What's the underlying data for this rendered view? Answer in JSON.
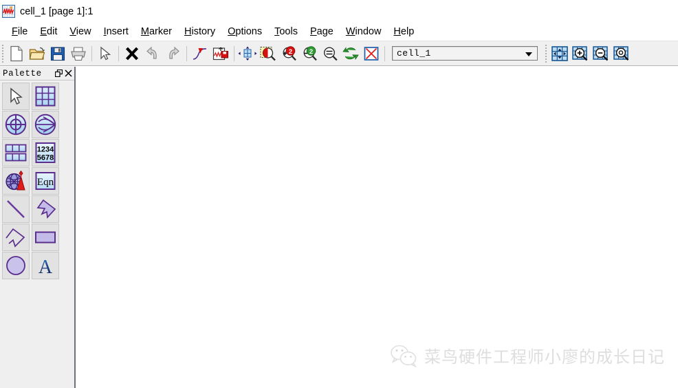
{
  "window": {
    "title": "cell_1 [page 1]:1",
    "icon": "waveform-graph-icon"
  },
  "menubar": {
    "items": [
      {
        "label": "File",
        "mnemonic": "F",
        "name": "menu-file"
      },
      {
        "label": "Edit",
        "mnemonic": "E",
        "name": "menu-edit"
      },
      {
        "label": "View",
        "mnemonic": "V",
        "name": "menu-view"
      },
      {
        "label": "Insert",
        "mnemonic": "I",
        "name": "menu-insert"
      },
      {
        "label": "Marker",
        "mnemonic": "M",
        "name": "menu-marker"
      },
      {
        "label": "History",
        "mnemonic": "H",
        "name": "menu-history"
      },
      {
        "label": "Options",
        "mnemonic": "O",
        "name": "menu-options"
      },
      {
        "label": "Tools",
        "mnemonic": "T",
        "name": "menu-tools"
      },
      {
        "label": "Page",
        "mnemonic": "P",
        "name": "menu-page"
      },
      {
        "label": "Window",
        "mnemonic": "W",
        "name": "menu-window"
      },
      {
        "label": "Help",
        "mnemonic": "H",
        "name": "menu-help"
      }
    ]
  },
  "toolbar": {
    "groups": [
      {
        "name": "file-group",
        "buttons": [
          {
            "name": "new-document-button",
            "icon": "new-document-icon",
            "tooltip": "New"
          },
          {
            "name": "open-file-button",
            "icon": "open-folder-icon",
            "tooltip": "Open"
          },
          {
            "name": "save-button",
            "icon": "floppy-disk-icon",
            "tooltip": "Save"
          },
          {
            "name": "print-button",
            "icon": "printer-icon",
            "tooltip": "Print"
          }
        ]
      },
      {
        "name": "select-group",
        "buttons": [
          {
            "name": "select-pointer-button",
            "icon": "cursor-arrow-icon",
            "tooltip": "Select"
          }
        ]
      },
      {
        "name": "edit-group",
        "buttons": [
          {
            "name": "delete-button",
            "icon": "black-x-icon",
            "tooltip": "Delete"
          },
          {
            "name": "undo-button",
            "icon": "undo-arrow-icon",
            "tooltip": "Undo"
          },
          {
            "name": "redo-button",
            "icon": "redo-arrow-icon",
            "tooltip": "Redo"
          }
        ]
      },
      {
        "name": "signal-group",
        "buttons": [
          {
            "name": "plot-curve-button",
            "icon": "curve-arrow-icon",
            "tooltip": "Plot"
          },
          {
            "name": "save-waveform-button",
            "icon": "waveform-save-icon",
            "tooltip": "Save Waveform"
          }
        ]
      },
      {
        "name": "view-group",
        "buttons": [
          {
            "name": "pan-button",
            "icon": "pan-grid-arrows-icon",
            "tooltip": "Pan"
          },
          {
            "name": "zoom-region-button",
            "icon": "zoom-region-icon",
            "tooltip": "Zoom Region"
          },
          {
            "name": "zoom-in-2x-button",
            "icon": "zoom-in-red-2-icon",
            "tooltip": "Zoom In 2x"
          },
          {
            "name": "zoom-out-2x-button",
            "icon": "zoom-out-green-2-icon",
            "tooltip": "Zoom Out 2x"
          },
          {
            "name": "zoom-fit-button",
            "icon": "magnifier-fit-icon",
            "tooltip": "Fit"
          },
          {
            "name": "refresh-button",
            "icon": "refresh-green-arrows-icon",
            "tooltip": "Redraw"
          },
          {
            "name": "stop-button",
            "icon": "red-x-box-icon",
            "tooltip": "Stop"
          }
        ]
      }
    ],
    "cell_selector": {
      "name": "cell-selector-combobox",
      "value": "cell_1",
      "placeholder": "cell_1"
    },
    "grid_nav": [
      {
        "name": "grid-pan-button",
        "icon": "grid-pan-icon",
        "tooltip": "Grid Pan"
      },
      {
        "name": "grid-zoom-in-button",
        "icon": "grid-zoom-in-icon",
        "tooltip": "Grid Zoom In"
      },
      {
        "name": "grid-zoom-out-button",
        "icon": "grid-zoom-out-icon",
        "tooltip": "Grid Zoom Out"
      },
      {
        "name": "grid-zoom-fit-button",
        "icon": "grid-zoom-fit-icon",
        "tooltip": "Grid Fit"
      }
    ]
  },
  "palette": {
    "title": "Palette",
    "undock_label": "❐",
    "close_label": "✕",
    "tools": [
      {
        "name": "palette-tool-select",
        "icon": "cursor-arrow-icon",
        "label": ""
      },
      {
        "name": "palette-tool-grid",
        "icon": "grid-table-icon",
        "label": ""
      },
      {
        "name": "palette-tool-crosshair",
        "icon": "circle-crosshair-icon",
        "label": ""
      },
      {
        "name": "palette-tool-smith",
        "icon": "circle-mesh-icon",
        "label": ""
      },
      {
        "name": "palette-tool-table",
        "icon": "table-rows-icon",
        "label": ""
      },
      {
        "name": "palette-tool-numbers",
        "icon": "numeric-pad-icon",
        "label": "1234\n5678"
      },
      {
        "name": "palette-tool-antenna",
        "icon": "globe-antenna-icon",
        "label": ""
      },
      {
        "name": "palette-tool-equation",
        "icon": "equation-icon",
        "label": "Eqn"
      },
      {
        "name": "palette-tool-line",
        "icon": "diagonal-line-icon",
        "label": ""
      },
      {
        "name": "palette-tool-polygon",
        "icon": "filled-polygon-icon",
        "label": ""
      },
      {
        "name": "palette-tool-polyline",
        "icon": "open-polyline-icon",
        "label": ""
      },
      {
        "name": "palette-tool-rectangle",
        "icon": "rectangle-icon",
        "label": ""
      },
      {
        "name": "palette-tool-circle",
        "icon": "circle-icon",
        "label": ""
      },
      {
        "name": "palette-tool-text",
        "icon": "letter-a-text-icon",
        "label": "A"
      }
    ]
  },
  "canvas": {
    "watermark": {
      "icon": "wechat-logo-icon",
      "text": "菜鸟硬件工程师小廖的成长日记"
    }
  },
  "colors": {
    "palette_bg": "#efefef",
    "toolbar_bg": "#f0f0f0",
    "canvas_bg": "#ffffff",
    "icon_purple": "#5b2d8e",
    "icon_blue": "#bfe0f5",
    "accent_red": "#d81010",
    "accent_green": "#1f9c3a",
    "watermark_gray": "#dedede",
    "panel_border": "#6b707a"
  }
}
